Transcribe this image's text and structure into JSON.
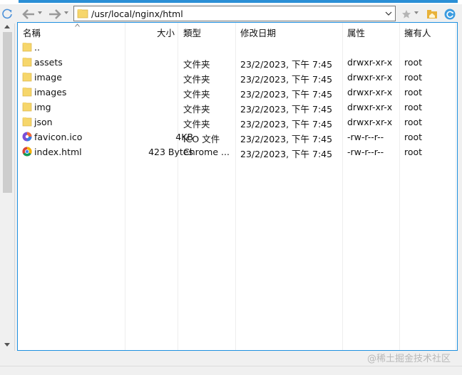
{
  "path": {
    "value": "/usr/local/nginx/html"
  },
  "columns": {
    "name": "名稱",
    "size": "大小",
    "type": "類型",
    "modified": "修改日期",
    "permissions": "属性",
    "owner": "擁有人"
  },
  "files": [
    {
      "name": "..",
      "size": "",
      "type": "",
      "modified": "",
      "permissions": "",
      "owner": "",
      "icon": "parent-folder"
    },
    {
      "name": "assets",
      "size": "",
      "type": "文件夹",
      "modified": "23/2/2023, 下午 7:45",
      "permissions": "drwxr-xr-x",
      "owner": "root",
      "icon": "folder"
    },
    {
      "name": "image",
      "size": "",
      "type": "文件夹",
      "modified": "23/2/2023, 下午 7:45",
      "permissions": "drwxr-xr-x",
      "owner": "root",
      "icon": "folder"
    },
    {
      "name": "images",
      "size": "",
      "type": "文件夹",
      "modified": "23/2/2023, 下午 7:45",
      "permissions": "drwxr-xr-x",
      "owner": "root",
      "icon": "folder"
    },
    {
      "name": "img",
      "size": "",
      "type": "文件夹",
      "modified": "23/2/2023, 下午 7:45",
      "permissions": "drwxr-xr-x",
      "owner": "root",
      "icon": "folder"
    },
    {
      "name": "json",
      "size": "",
      "type": "文件夹",
      "modified": "23/2/2023, 下午 7:45",
      "permissions": "drwxr-xr-x",
      "owner": "root",
      "icon": "folder"
    },
    {
      "name": "favicon.ico",
      "size": "4KB",
      "type": "ICO 文件",
      "modified": "23/2/2023, 下午 7:45",
      "permissions": "-rw-r--r--",
      "owner": "root",
      "icon": "ico-file"
    },
    {
      "name": "index.html",
      "size": "423 Bytes",
      "type": "Chrome ...",
      "modified": "23/2/2023, 下午 7:45",
      "permissions": "-rw-r--r--",
      "owner": "root",
      "icon": "chrome-html-file"
    }
  ],
  "watermark": "@稀土掘金技术社区",
  "colors": {
    "accent": "#1e90e0",
    "folder": "#f6d66b"
  }
}
